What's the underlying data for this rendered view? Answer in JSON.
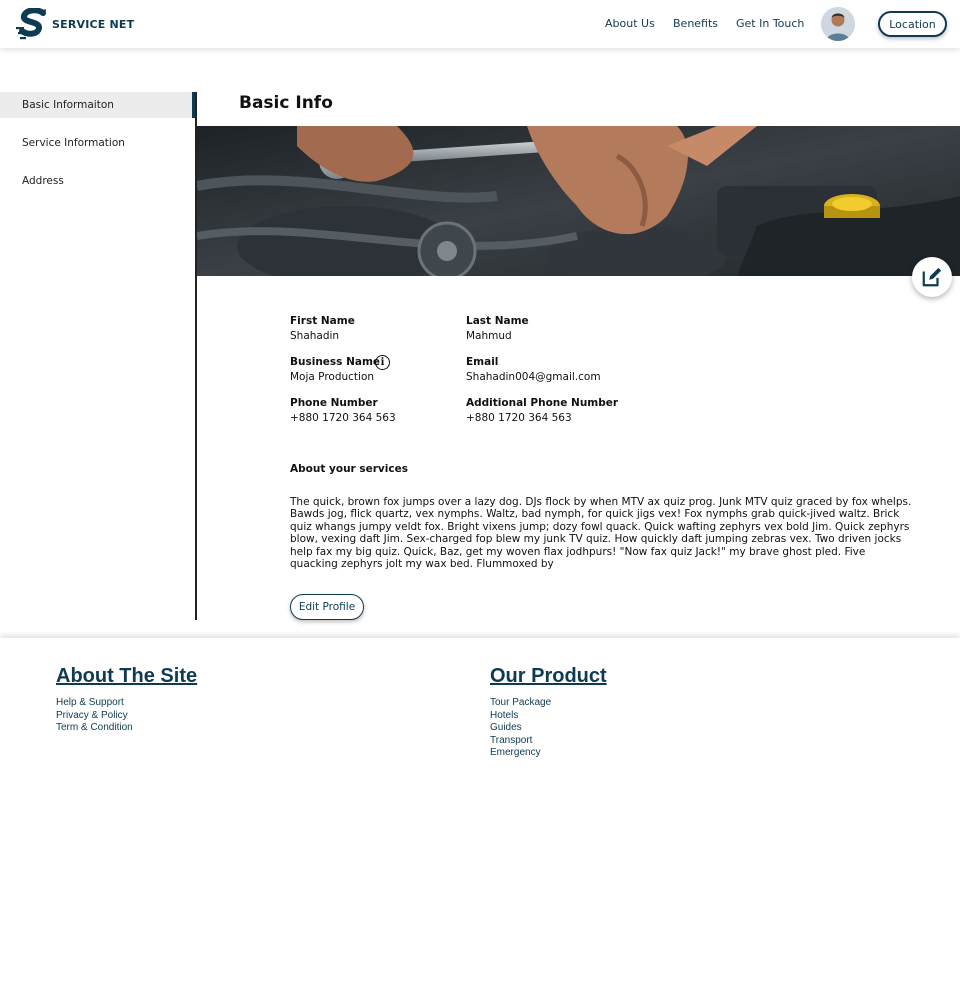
{
  "header": {
    "brand": "SERVICE NET",
    "nav": [
      "About Us",
      "Benefits",
      "Get In Touch"
    ],
    "location_label": "Location"
  },
  "sidebar": {
    "items": [
      {
        "label": "Basic Informaiton",
        "active": true
      },
      {
        "label": "Service Information",
        "active": false
      },
      {
        "label": "Address",
        "active": false
      }
    ]
  },
  "main": {
    "title": "Basic Info",
    "fields": {
      "first_name": {
        "label": "First Name",
        "value": "Shahadin"
      },
      "last_name": {
        "label": "Last Name",
        "value": "Mahmud"
      },
      "business_name": {
        "label": "Business Name",
        "value": "Moja Production"
      },
      "email": {
        "label": "Email",
        "value": "Shahadin004@gmail.com"
      },
      "phone": {
        "label": "Phone Number",
        "value": "+880 1720 364 563"
      },
      "additional_phone": {
        "label": "Additional Phone Number",
        "value": "+880 1720 364 563"
      }
    },
    "about_title": "About your services",
    "about_text": "The quick, brown fox jumps over a lazy dog. DJs flock by when MTV ax quiz prog. Junk MTV quiz graced by fox whelps. Bawds jog, flick quartz, vex nymphs. Waltz, bad nymph, for quick jigs vex! Fox nymphs grab quick-jived waltz. Brick quiz whangs jumpy veldt fox. Bright vixens jump; dozy fowl quack. Quick wafting zephyrs vex bold Jim. Quick zephyrs blow, vexing daft Jim. Sex-charged fop blew my junk TV quiz. How quickly daft jumping zebras vex. Two driven jocks help fax my big quiz. Quick, Baz, get my woven flax jodhpurs! \"Now fax quiz Jack!\" my brave ghost pled. Five quacking zephyrs jolt my wax bed. Flummoxed by",
    "edit_profile_label": "Edit Profile"
  },
  "footer": {
    "about": {
      "title": "About The Site",
      "links": [
        "Help & Support",
        "Privacy & Policy",
        "Term & Condition"
      ]
    },
    "product": {
      "title": "Our Product",
      "links": [
        "Tour Package",
        "Hotels",
        "Guides",
        "Transport",
        "Emergency"
      ]
    }
  },
  "colors": {
    "brand": "#0f3b52",
    "sidebar_active_bg": "#ececec"
  },
  "icons": {
    "logo": "service-net-logo-icon",
    "info": "info-icon",
    "edit": "edit-icon"
  }
}
